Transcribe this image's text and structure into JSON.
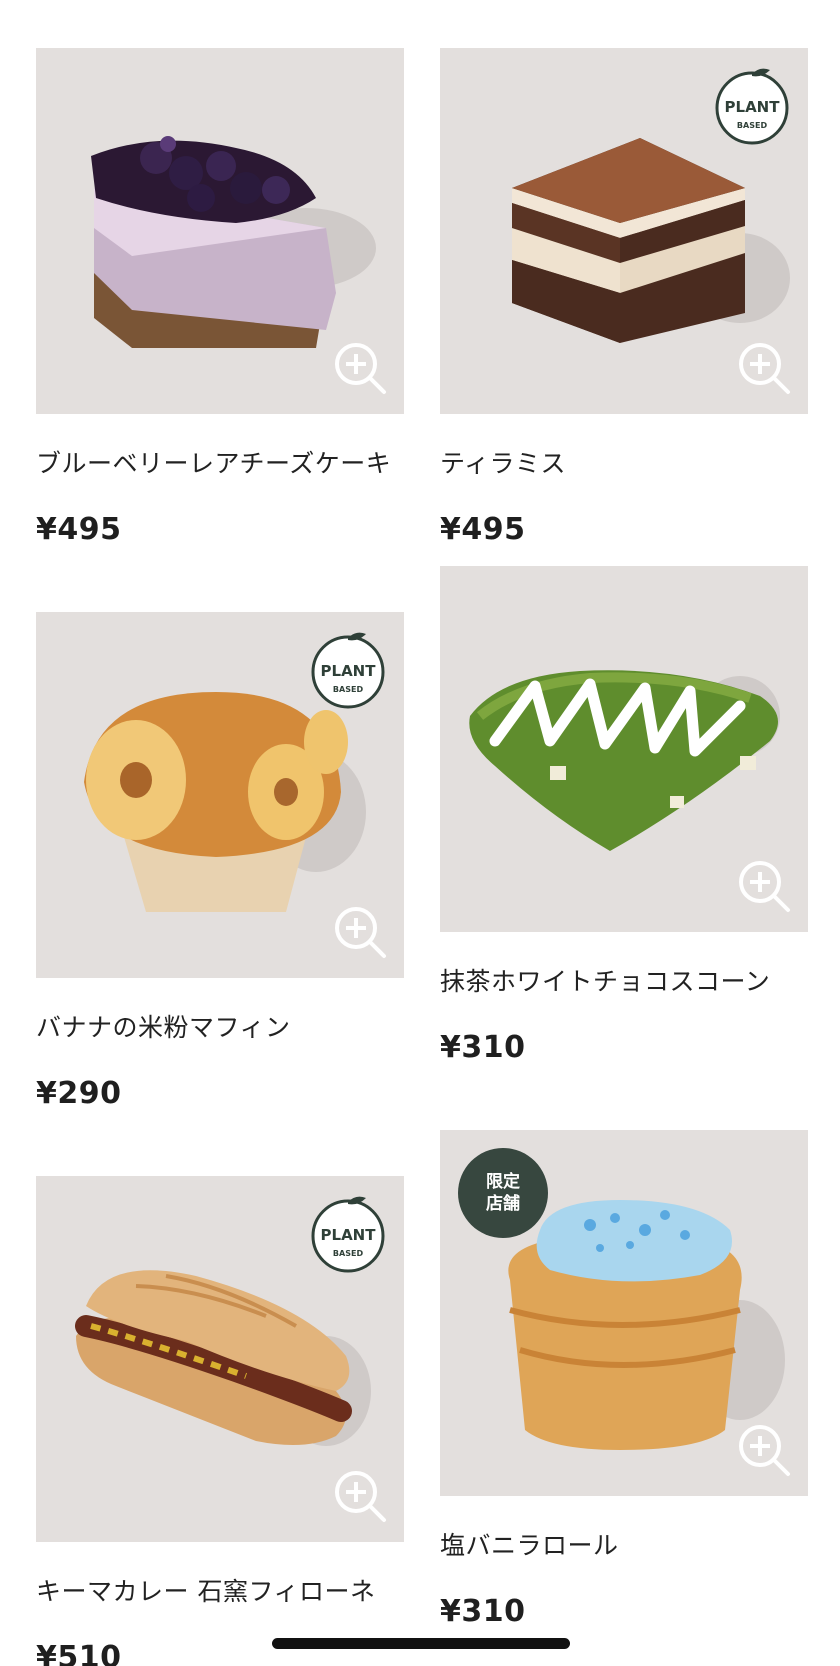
{
  "products": [
    {
      "name": "ブルーベリーレアチーズケーキ",
      "price": "¥495",
      "badge": "",
      "image": "blueberry-cheesecake"
    },
    {
      "name": "ティラミス",
      "price": "¥495",
      "badge": "PLANT BASED",
      "image": "tiramisu"
    },
    {
      "name": "バナナの米粉マフィン",
      "price": "¥290",
      "badge": "PLANT BASED",
      "image": "banana-muffin"
    },
    {
      "name": "抹茶ホワイトチョコスコーン",
      "price": "¥310",
      "badge": "",
      "image": "matcha-scone"
    },
    {
      "name": "キーマカレー 石窯フィローネ",
      "price": "¥510",
      "badge": "PLANT BASED",
      "image": "keema-filone"
    },
    {
      "name": "塩バニラロール",
      "price": "¥310",
      "badge": "限定\n店舗",
      "image": "salt-vanilla-roll"
    }
  ],
  "badges": {
    "plant_top": "PLANT",
    "plant_bottom": "BASED",
    "limited": "限定\n店舗"
  },
  "icons": {
    "zoom": "zoom-in-icon",
    "plant": "plant-based-badge-icon"
  },
  "colors": {
    "photo_bg": "#e3dfdd",
    "badge_green": "#37473f",
    "text": "#222222"
  }
}
